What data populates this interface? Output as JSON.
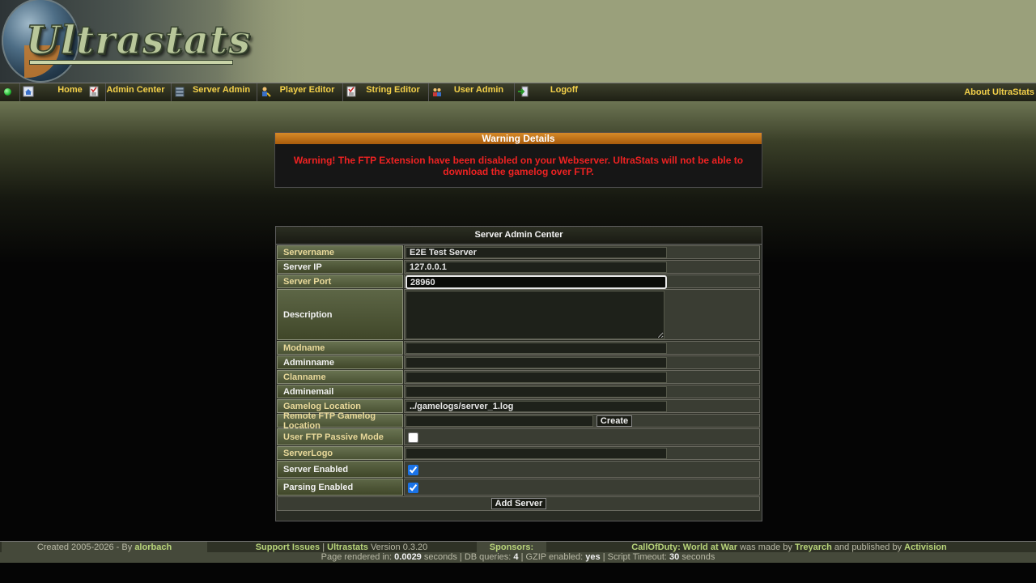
{
  "header": {
    "logo_text": "Ultrastats"
  },
  "menu": {
    "items": [
      {
        "label": "Home",
        "icon": "home-icon"
      },
      {
        "label": "Admin Center",
        "icon": "checklist-icon"
      },
      {
        "label": "Server Admin",
        "icon": "server-icon"
      },
      {
        "label": "Player Editor",
        "icon": "player-icon"
      },
      {
        "label": "String Editor",
        "icon": "checklist-icon"
      },
      {
        "label": "User Admin",
        "icon": "users-icon"
      },
      {
        "label": "Logoff",
        "icon": "logoff-icon"
      }
    ],
    "about": "About UltraStats"
  },
  "warning": {
    "title": "Warning Details",
    "text": "Warning! The FTP Extension have been disabled on your Webserver. UltraStats will not be able to download the gamelog over FTP."
  },
  "panel": {
    "title": "Server Admin Center",
    "labels": {
      "servername": "Servername",
      "server_ip": "Server IP",
      "server_port": "Server Port",
      "description": "Description",
      "modname": "Modname",
      "adminname": "Adminname",
      "clanname": "Clanname",
      "adminemail": "Adminemail",
      "gamelog_location": "Gamelog Location",
      "remote_ftp": "Remote FTP Gamelog Location",
      "ftp_passive": "User FTP Passive Mode",
      "serverlogo": "ServerLogo",
      "server_enabled": "Server Enabled",
      "parsing_enabled": "Parsing Enabled"
    },
    "values": {
      "servername": "E2E Test Server",
      "server_ip": "127.0.0.1",
      "server_port": "28960",
      "description": "",
      "modname": "",
      "adminname": "",
      "clanname": "",
      "adminemail": "",
      "gamelog_location": "../gamelogs/server_1.log",
      "remote_ftp": "",
      "serverlogo": ""
    },
    "checks": {
      "ftp_passive": false,
      "server_enabled": true,
      "parsing_enabled": true
    },
    "create_button": "Create",
    "add_button": "Add Server"
  },
  "footer": {
    "created": "Created 2005-2026 - By",
    "author": "alorbach",
    "support": "Support Issues",
    "sep": "|",
    "product": "Ultrastats",
    "version": "Version 0.3.20",
    "sponsors": "Sponsors:",
    "game": "CallOfDuty: World at War",
    "made_by_text": "was made by",
    "developer": "Treyarch",
    "published_text": "and published by",
    "publisher": "Activision",
    "rendered_label": "Page rendered in:",
    "rendered_value": "0.0029",
    "seconds1": "seconds",
    "dbq_label": "| DB queries:",
    "dbq_value": "4",
    "gzip_label": "| GZIP enabled:",
    "gzip_value": "yes",
    "timeout_label": "| Script Timeout:",
    "timeout_value": "30",
    "seconds2": "seconds"
  }
}
